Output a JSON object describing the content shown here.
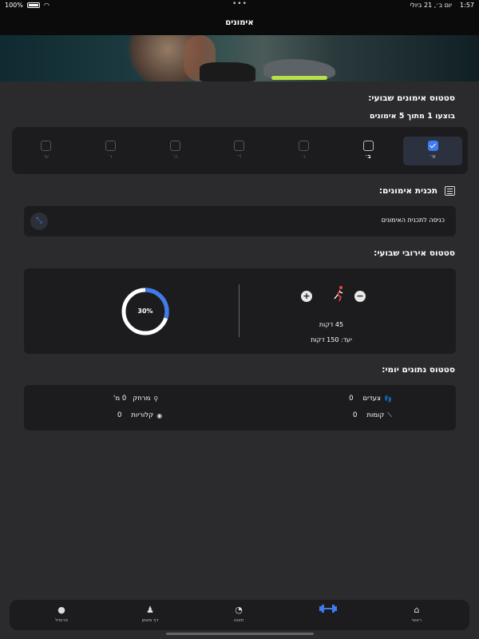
{
  "status_bar": {
    "battery": "100%",
    "date": "יום ב׳, 21 ביולי",
    "time": "1:57",
    "dots": "•••"
  },
  "header": {
    "title": "אימונים"
  },
  "weekly_workout": {
    "title": "סטטוס אימונים שבועי:",
    "summary": "בוצעו 1 מתוך 5 אימונים",
    "days": [
      {
        "label": "א׳",
        "state": "done"
      },
      {
        "label": "ב׳",
        "state": "today"
      },
      {
        "label": "ג׳",
        "state": "pending"
      },
      {
        "label": "ד׳",
        "state": "pending"
      },
      {
        "label": "ה׳",
        "state": "pending"
      },
      {
        "label": "ו׳",
        "state": "pending"
      },
      {
        "label": "ש׳",
        "state": "pending"
      }
    ]
  },
  "training_plan": {
    "title": "תכנית אימונים:",
    "link_text": "כניסה לתכנית האימונים",
    "list_icon": "list-icon",
    "expand_icon": "expand-icon"
  },
  "aerobic": {
    "title": "סטטוס אירובי שבועי:",
    "progress_percent": 30,
    "progress_label": "30%",
    "minutes": "45 דקות",
    "goal": "יעד: 150 דקות",
    "plus": "+",
    "minus": "−"
  },
  "daily": {
    "title": "סטטוס נתונים יומי:",
    "steps_label": "צעדים",
    "steps_value": "0",
    "floors_label": "קומות",
    "floors_value": "0",
    "distance_label": "מרחק",
    "distance_value": "0 מ'",
    "calories_label": "קלוריות",
    "calories_value": "0"
  },
  "tabs": [
    {
      "label": "ראשי",
      "icon": "home-icon",
      "glyph": "⌂"
    },
    {
      "label": "",
      "icon": "dumbbell-icon",
      "glyph": "▬"
    },
    {
      "label": "תזונה",
      "icon": "apple-icon",
      "glyph": "◔"
    },
    {
      "label": "דף מאמן",
      "icon": "coach-icon",
      "glyph": "♟"
    },
    {
      "label": "פרופיל",
      "icon": "profile-icon",
      "glyph": "●"
    }
  ],
  "colors": {
    "background": "#2b2b2d",
    "card": "#1c1c1e",
    "accent": "#3d7bf0",
    "header": "#0b0b0b"
  }
}
